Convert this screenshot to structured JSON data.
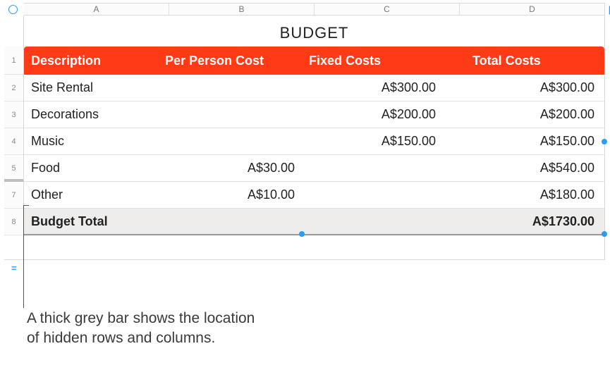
{
  "columns": [
    "A",
    "B",
    "C",
    "D"
  ],
  "rowNumbers": [
    "1",
    "2",
    "3",
    "4",
    "5",
    "7",
    "8"
  ],
  "rowGapAfterIndex": 4,
  "title": "BUDGET",
  "headers": {
    "desc": "Description",
    "per": "Per Person Cost",
    "fixed": "Fixed Costs",
    "total": "Total Costs"
  },
  "rows": [
    {
      "desc": "Site Rental",
      "per": "",
      "fixed": "A$300.00",
      "total": "A$300.00"
    },
    {
      "desc": "Decorations",
      "per": "",
      "fixed": "A$200.00",
      "total": "A$200.00"
    },
    {
      "desc": "Music",
      "per": "",
      "fixed": "A$150.00",
      "total": "A$150.00"
    },
    {
      "desc": "Food",
      "per": "A$30.00",
      "fixed": "",
      "total": "A$540.00"
    },
    {
      "desc": "Other",
      "per": "A$10.00",
      "fixed": "",
      "total": "A$180.00"
    }
  ],
  "totalRow": {
    "desc": "Budget Total",
    "per": "",
    "fixed": "",
    "total": "A$1730.00"
  },
  "callout": "A thick grey bar shows the location of hidden rows and columns.",
  "chart_data": {
    "type": "table",
    "title": "BUDGET",
    "columns": [
      "Description",
      "Per Person Cost",
      "Fixed Costs",
      "Total Costs"
    ],
    "rows": [
      [
        "Site Rental",
        null,
        300.0,
        300.0
      ],
      [
        "Decorations",
        null,
        200.0,
        200.0
      ],
      [
        "Music",
        null,
        150.0,
        150.0
      ],
      [
        "Food",
        30.0,
        null,
        540.0
      ],
      [
        "Other",
        10.0,
        null,
        180.0
      ],
      [
        "Budget Total",
        null,
        null,
        1730.0
      ]
    ],
    "currency": "A$",
    "hidden_rows": [
      6
    ]
  }
}
